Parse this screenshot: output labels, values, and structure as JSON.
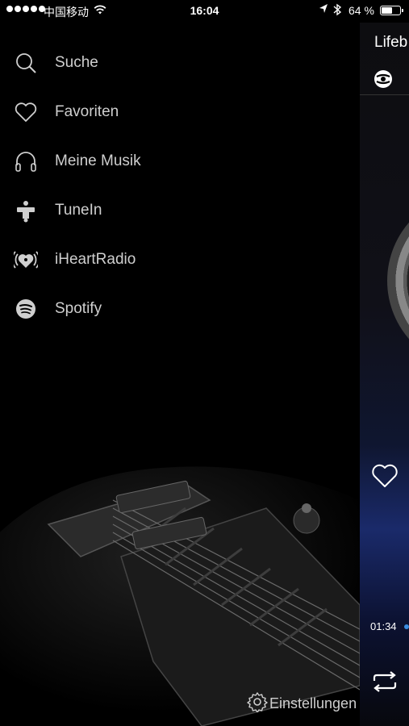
{
  "status_bar": {
    "carrier": "中国移动",
    "time": "16:04",
    "battery_percent_label": "64 %",
    "battery_level": 0.64
  },
  "menu": {
    "items": [
      {
        "label": "Suche",
        "icon": "search-icon"
      },
      {
        "label": "Favoriten",
        "icon": "heart-icon"
      },
      {
        "label": "Meine Musik",
        "icon": "headphones-icon"
      },
      {
        "label": "TuneIn",
        "icon": "tunein-icon"
      },
      {
        "label": "iHeartRadio",
        "icon": "iheartradio-icon"
      },
      {
        "label": "Spotify",
        "icon": "spotify-icon"
      }
    ],
    "settings_label": "Einstellungen"
  },
  "player": {
    "title_partial": "Lifeb",
    "elapsed": "01:34",
    "accent_color": "#3b8de0"
  }
}
